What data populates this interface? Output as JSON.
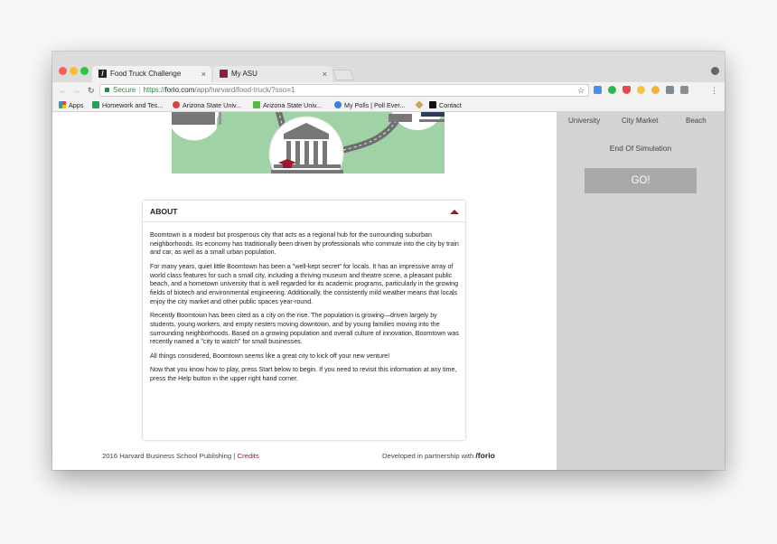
{
  "tabs": [
    {
      "title": "Food Truck Challenge",
      "icon": "forio-favicon",
      "active": true
    },
    {
      "title": "My ASU",
      "icon": "asu-favicon",
      "active": false
    }
  ],
  "toolbar": {
    "secure_label": "Secure",
    "url_scheme": "https://",
    "url_host": "forio.com",
    "url_path": "/app/harvard/food-truck/?sso=1"
  },
  "bookmarks": [
    {
      "label": "Apps",
      "icon": "apps-grid-icon"
    },
    {
      "label": "Homework and Tes...",
      "icon": "p-bookmark-icon"
    },
    {
      "label": "Arizona State Univ...",
      "icon": "asu-bookmark-icon"
    },
    {
      "label": "Arizona State Univ...",
      "icon": "asu-green-bookmark-icon"
    },
    {
      "label": "My Polls | Poll Ever...",
      "icon": "poll-everywhere-icon"
    },
    {
      "label": "",
      "icon": "diamond-bookmark-icon"
    },
    {
      "label": "Contact",
      "icon": "x-bookmark-icon"
    }
  ],
  "sidebar": {
    "locations": [
      "University",
      "City Market",
      "Beach"
    ],
    "end_simulation": "End Of Simulation",
    "go_label": "GO!"
  },
  "about": {
    "title": "ABOUT",
    "paragraphs": [
      "Boomtown is a modest but prosperous city that acts as a regional hub for the surrounding suburban neighborhoods. Its economy has traditionally been driven by professionals who commute into the city by train and car, as well as a small urban population.",
      "For many years, quiet little Boomtown has been a \"well-kept secret\" for locals. It has an impressive array of world class features for such a small city, including a thriving museum and theatre scene, a pleasant public beach, and a hometown university that is well regarded for its academic programs, particularly in the growing fields of biotech and environmental engineering. Additionally, the consistently mild weather means that locals enjoy the city market and other public spaces year-round.",
      "Recently Boomtown has been cited as a city on the rise. The population is growing—driven largely by students, young workers, and empty nesters moving downtown, and by young families moving into the surrounding neighborhoods. Based on a growing population and overall culture of innovation, Boomtown was recently named a \"city to watch\" for small businesses.",
      "All things considered, Boomtown seems like a great city to kick off your new venture!",
      "Now that you know how to play, press Start below to begin. If you need to revisit this information at any time, press the Help button in the upper right hand corner."
    ]
  },
  "footer": {
    "copyright": "2016 Harvard Business School Publishing | ",
    "credits": "Credits",
    "partner": "Developed in partnership with ",
    "brand": "/forio"
  },
  "colors": {
    "accent": "#8b1e2d",
    "map_green": "#9fd3a6",
    "sidebar_bg": "#d3d3d3",
    "go_button": "#a8a8a8",
    "secure_green": "#1e8e3e"
  }
}
